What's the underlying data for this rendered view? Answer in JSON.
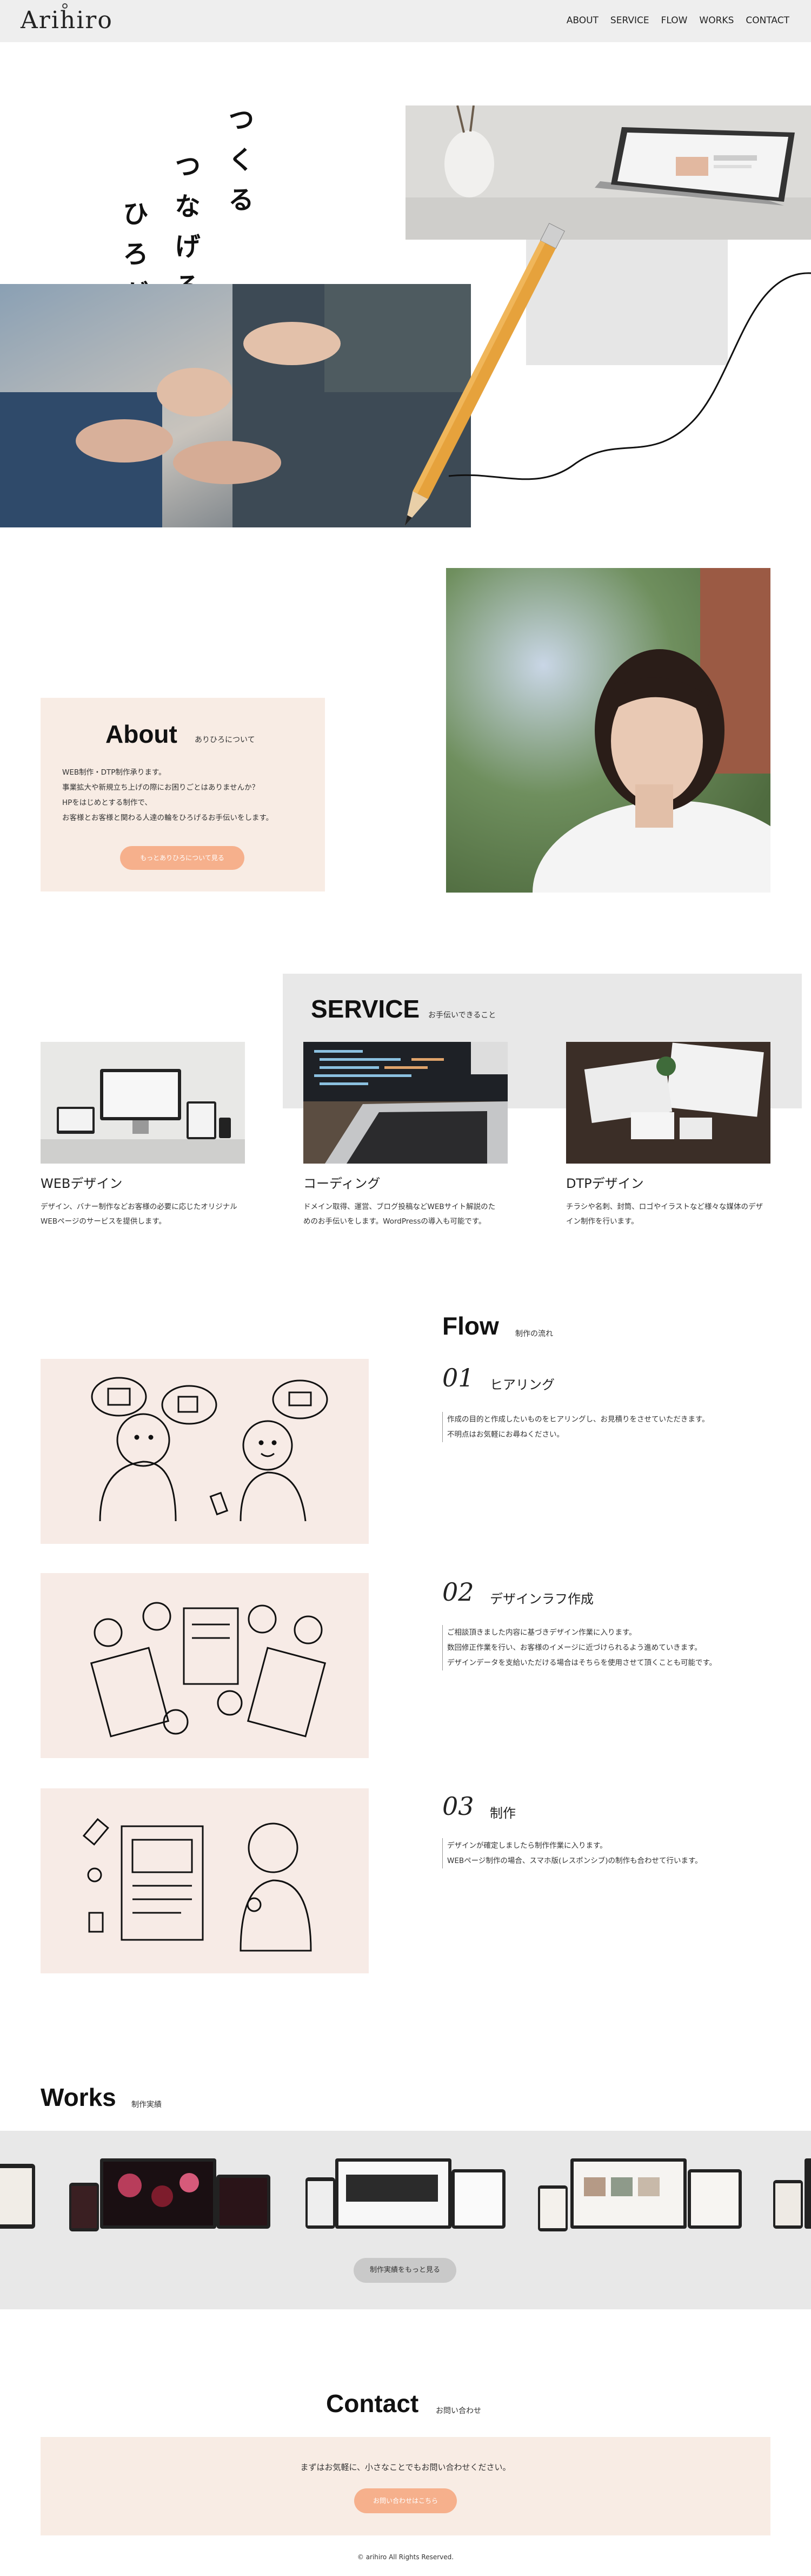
{
  "header": {
    "logo": "Arihiro",
    "nav": [
      "ABOUT",
      "SERVICE",
      "FLOW",
      "WORKS",
      "CONTACT"
    ]
  },
  "hero": {
    "lines": [
      "つくる",
      "つなげる",
      "ひろがる"
    ]
  },
  "about": {
    "title": "About",
    "subtitle": "ありひろについて",
    "body": [
      "WEB制作・DTP制作承ります。",
      "事業拡大や新規立ち上げの際にお困りごとはありませんか？",
      "HPをはじめとする制作で、",
      "お客様とお客様と関わる人達の輪をひろげるお手伝いをします。"
    ],
    "button": "もっとありひろについて見る"
  },
  "service": {
    "title": "SERVICE",
    "subtitle": "お手伝いできること",
    "items": [
      {
        "title": "WEBデザイン",
        "text": [
          "デザイン、バナー制作などお客様の必要に応じたオリジナル",
          "WEBページのサービスを提供します。"
        ]
      },
      {
        "title": "コーディング",
        "text": [
          "ドメイン取得、運営、ブログ投稿などWEBサイト解説のた",
          "めのお手伝いをします。WordPressの導入も可能です。"
        ]
      },
      {
        "title": "DTPデザイン",
        "text": [
          "チラシや名刺、封筒、ロゴやイラストなど様々な媒体のデザ",
          "イン制作を行います。"
        ]
      }
    ]
  },
  "flow": {
    "title": "Flow",
    "subtitle": "制作の流れ",
    "steps": [
      {
        "num": "01",
        "title": "ヒアリング",
        "text": [
          "作成の目的と作成したいものをヒアリングし、お見積りをさせていただきます。",
          "不明点はお気軽にお尋ねください。"
        ]
      },
      {
        "num": "02",
        "title": "デザインラフ作成",
        "text": [
          "ご相談頂きました内容に基づきデザイン作業に入ります。",
          "数回修正作業を行い、お客様のイメージに近づけられるよう進めていきます。",
          "デザインデータを支給いただける場合はそちらを使用させて頂くことも可能です。"
        ]
      },
      {
        "num": "03",
        "title": "制作",
        "text": [
          "デザインが確定しましたら制作作業に入ります。",
          "WEBページ制作の場合、スマホ版(レスポンシブ)の制作も合わせて行います。"
        ]
      }
    ]
  },
  "works": {
    "title": "Works",
    "subtitle": "制作実績",
    "button": "制作実績をもっと見る"
  },
  "contact": {
    "title": "Contact",
    "subtitle": "お問い合わせ",
    "text": "まずはお気軽に、小さなことでもお問い合わせください。",
    "button": "お問い合わせはこちら"
  },
  "footer": {
    "copyright": "© arihiro All Rights Reserved."
  }
}
